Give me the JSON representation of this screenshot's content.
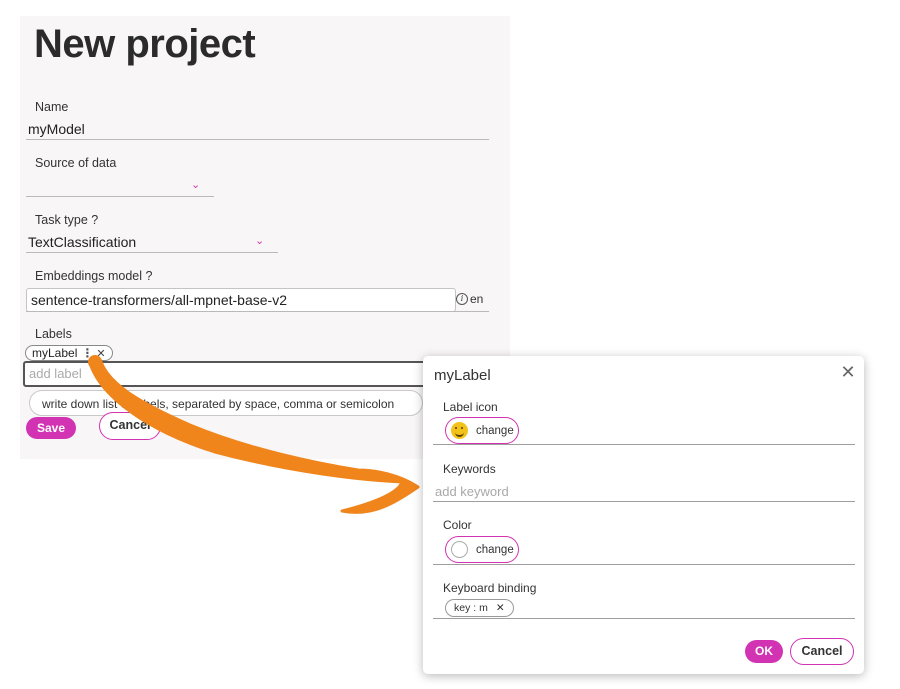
{
  "form": {
    "title": "New project",
    "name_label": "Name",
    "name_value": "myModel",
    "source_label": "Source of data",
    "source_value": "",
    "task_label": "Task type",
    "task_help": "?",
    "task_value": "TextClassification",
    "embed_label": "Embeddings model",
    "embed_help": "?",
    "embed_value": "sentence-transformers/all-mpnet-base-v2",
    "embed_lang": "en",
    "labels_label": "Labels",
    "chips": [
      {
        "label": "myLabel"
      }
    ],
    "add_label_placeholder": "add label",
    "hint": "write down list of labels, separated by space, comma or semicolon",
    "save_label": "Save",
    "cancel_label": "Cancel"
  },
  "dialog": {
    "title": "myLabel",
    "label_icon_label": "Label icon",
    "icon_change_label": "change",
    "keywords_label": "Keywords",
    "keywords_placeholder": "add keyword",
    "color_label": "Color",
    "color_change_label": "change",
    "keyboard_label": "Keyboard binding",
    "key_chip": "key : m",
    "ok_label": "OK",
    "cancel_label": "Cancel"
  },
  "colors": {
    "accent": "#d233b2",
    "arrow": "#f0851c",
    "panel_bg": "#f8f6f7"
  },
  "icons": {
    "dropdown": "chevron-down-icon",
    "info": "info-icon",
    "close": "close-icon",
    "chip_menu": "vertical-dots-icon",
    "chip_remove": "x-icon",
    "label_emoji": "smiley-emoji-icon"
  }
}
